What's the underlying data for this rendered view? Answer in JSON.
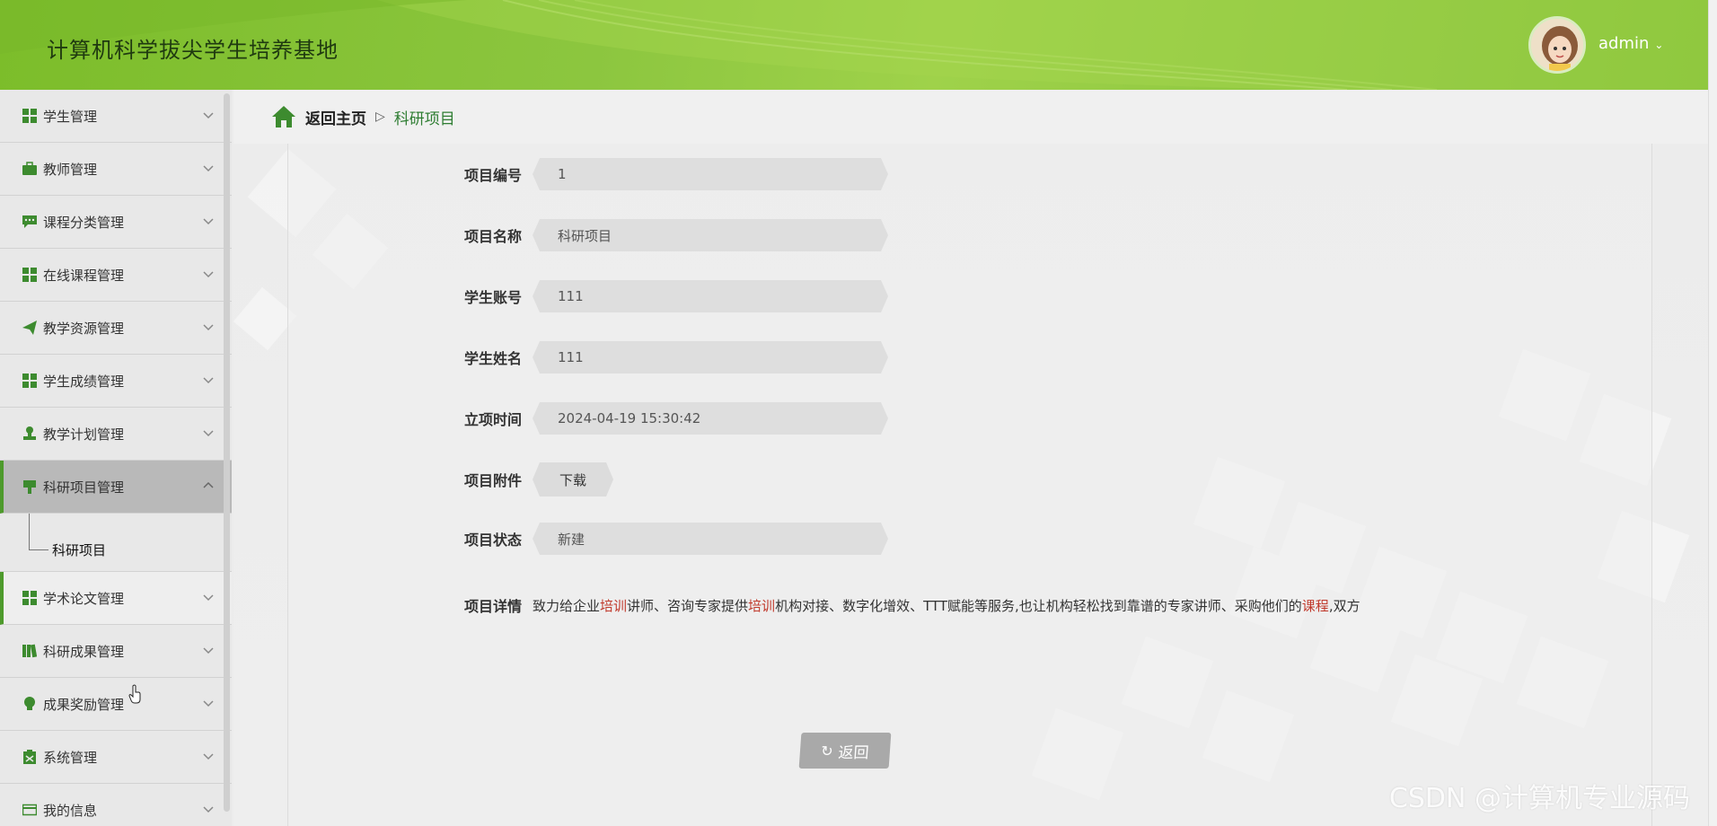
{
  "header": {
    "title": "计算机科学拔尖学生培养基地",
    "username": "admin",
    "caret": "⌄"
  },
  "sidebar": {
    "items": [
      {
        "label": "学生管理",
        "icon": "grid-icon"
      },
      {
        "label": "教师管理",
        "icon": "briefcase-icon"
      },
      {
        "label": "课程分类管理",
        "icon": "chat-icon"
      },
      {
        "label": "在线课程管理",
        "icon": "grid-icon"
      },
      {
        "label": "教学资源管理",
        "icon": "send-icon"
      },
      {
        "label": "学生成绩管理",
        "icon": "grid-icon"
      },
      {
        "label": "教学计划管理",
        "icon": "stamp-icon"
      },
      {
        "label": "科研项目管理",
        "icon": "brush-icon",
        "expanded": true
      },
      {
        "label": "学术论文管理",
        "icon": "grid-icon"
      },
      {
        "label": "科研成果管理",
        "icon": "book-icon"
      },
      {
        "label": "成果奖励管理",
        "icon": "bulb-icon"
      },
      {
        "label": "系统管理",
        "icon": "clipboard-icon"
      },
      {
        "label": "我的信息",
        "icon": "card-icon"
      }
    ],
    "submenu_label": "科研项目"
  },
  "breadcrumb": {
    "home": "返回主页",
    "separator": "▷",
    "current": "科研项目"
  },
  "form": {
    "fields": [
      {
        "label": "项目编号",
        "value": "1"
      },
      {
        "label": "项目名称",
        "value": "科研项目"
      },
      {
        "label": "学生账号",
        "value": "111"
      },
      {
        "label": "学生姓名",
        "value": "111"
      },
      {
        "label": "立项时间",
        "value": "2024-04-19 15:30:42"
      }
    ],
    "attachment_label": "项目附件",
    "download_label": "下载",
    "status_label": "项目状态",
    "status_value": "新建",
    "detail_label": "项目详情",
    "detail_parts": [
      "致力给企业",
      "培训",
      "讲师、咨询专家提供",
      "培训",
      "机构对接、数字化增效、TTT赋能等服务,也让机构轻松找到靠谱的专家讲师、采购他们的",
      "课程",
      ",双方"
    ]
  },
  "back_button": "返回",
  "watermark": "CSDN @计算机专业源码",
  "colors": {
    "accent": "#4e9a2c",
    "header": "#8cc63f",
    "highlight": "#c0392b"
  }
}
